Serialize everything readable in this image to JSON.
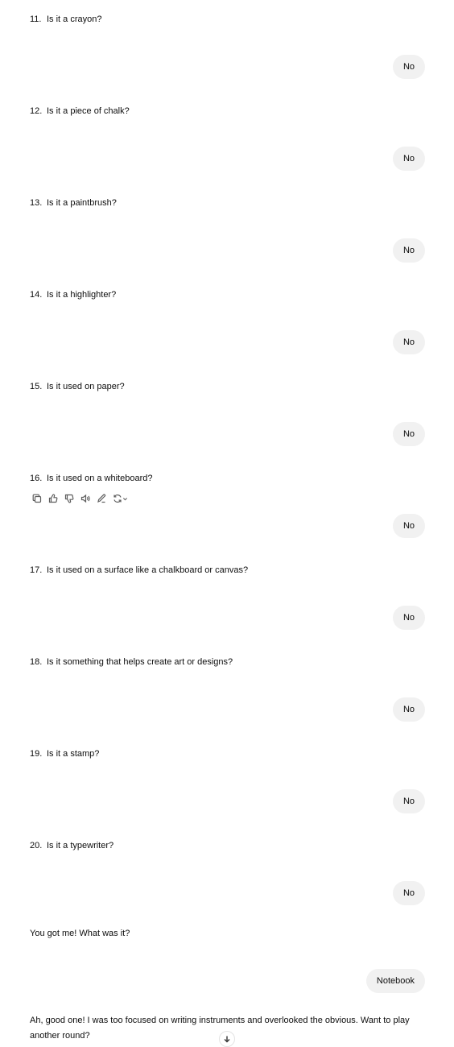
{
  "questions": [
    {
      "num": "11.",
      "text": "Is it a crayon?",
      "answer": "No"
    },
    {
      "num": "12.",
      "text": "Is it a piece of chalk?",
      "answer": "No"
    },
    {
      "num": "13.",
      "text": "Is it a paintbrush?",
      "answer": "No"
    },
    {
      "num": "14.",
      "text": "Is it a highlighter?",
      "answer": "No"
    },
    {
      "num": "15.",
      "text": "Is it used on paper?",
      "answer": "No"
    },
    {
      "num": "16.",
      "text": "Is it used on a whiteboard?",
      "answer": "No"
    },
    {
      "num": "17.",
      "text": "Is it used on a surface like a chalkboard or canvas?",
      "answer": "No"
    },
    {
      "num": "18.",
      "text": "Is it something that helps create art or designs?",
      "answer": "No"
    },
    {
      "num": "19.",
      "text": "Is it a stamp?",
      "answer": "No"
    },
    {
      "num": "20.",
      "text": "Is it a typewriter?",
      "answer": "No"
    }
  ],
  "assistant_reply_1": "You got me! What was it?",
  "user_reply": "Notebook",
  "assistant_reply_2": "Ah, good one! I was too focused on writing instruments and overlooked the obvious. Want to play another round?",
  "toolbar_icons": [
    "copy-icon",
    "thumbs-up-icon",
    "thumbs-down-icon",
    "read-aloud-icon",
    "edit-icon",
    "regenerate-icon"
  ]
}
